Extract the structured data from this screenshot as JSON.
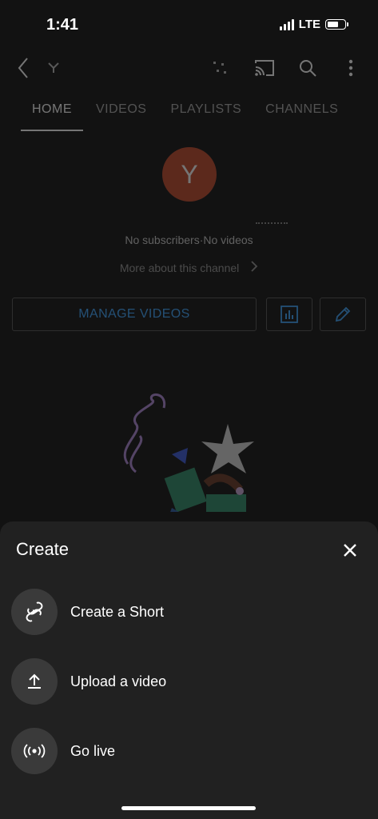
{
  "status": {
    "time": "1:41",
    "network": "LTE"
  },
  "tabs": [
    {
      "label": "HOME"
    },
    {
      "label": "VIDEOS"
    },
    {
      "label": "PLAYLISTS"
    },
    {
      "label": "CHANNELS"
    }
  ],
  "channel": {
    "avatar_letter": "Y",
    "subscribers": "No subscribers",
    "separator": "·",
    "videos": "No videos",
    "more_about": "More about this channel",
    "manage_videos": "MANAGE VIDEOS"
  },
  "sheet": {
    "title": "Create",
    "options": [
      {
        "label": "Create a Short",
        "icon": "shorts-icon"
      },
      {
        "label": "Upload a video",
        "icon": "upload-icon"
      },
      {
        "label": "Go live",
        "icon": "live-broadcast-icon"
      }
    ]
  },
  "colors": {
    "background": "#121212",
    "sheet": "#212121",
    "avatar": "#c34a2c",
    "accent_blue": "#3ea6ff"
  }
}
